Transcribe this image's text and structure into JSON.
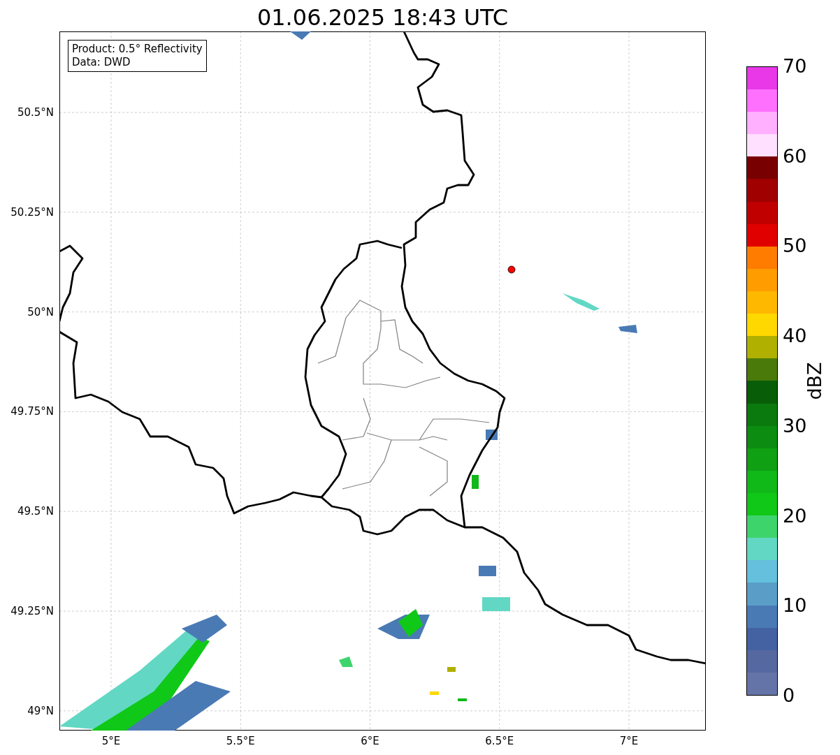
{
  "title": "01.06.2025 18:43 UTC",
  "info_box": {
    "lines": [
      "Product: 0.5° Reflectivity",
      "Data: DWD"
    ]
  },
  "map": {
    "lat_labels": [
      "50.5°N",
      "50.25°N",
      "50°N",
      "49.75°N",
      "49.5°N",
      "49.25°N",
      "49°N"
    ],
    "lon_labels": [
      "5°E",
      "5.5°E",
      "6°E",
      "6.5°E",
      "7°E"
    ]
  },
  "colorbar": {
    "label": "dBZ",
    "ticks": [
      "70",
      "60",
      "50",
      "40",
      "30",
      "20",
      "10",
      "0"
    ],
    "bands": [
      {
        "color": "#6474a8"
      },
      {
        "color": "#5668a0"
      },
      {
        "color": "#4462a2"
      },
      {
        "color": "#4a7ab4"
      },
      {
        "color": "#5a9ec8"
      },
      {
        "color": "#64c0dc"
      },
      {
        "color": "#62d8c4"
      },
      {
        "color": "#3ed46c"
      },
      {
        "color": "#10c818"
      },
      {
        "color": "#10b818"
      },
      {
        "color": "#10a014"
      },
      {
        "color": "#0c8c10"
      },
      {
        "color": "#0a7a0e"
      },
      {
        "color": "#085e08"
      },
      {
        "color": "#4a7a0a"
      },
      {
        "color": "#b0b000"
      },
      {
        "color": "#ffd800"
      },
      {
        "color": "#ffb800"
      },
      {
        "color": "#ff9c00"
      },
      {
        "color": "#ff7c00"
      },
      {
        "color": "#e00000"
      },
      {
        "color": "#c00000"
      },
      {
        "color": "#a00000"
      },
      {
        "color": "#780000"
      },
      {
        "color": "#ffe0ff"
      },
      {
        "color": "#ffb0ff"
      },
      {
        "color": "#ff70ff"
      },
      {
        "color": "#e838e8"
      }
    ]
  }
}
